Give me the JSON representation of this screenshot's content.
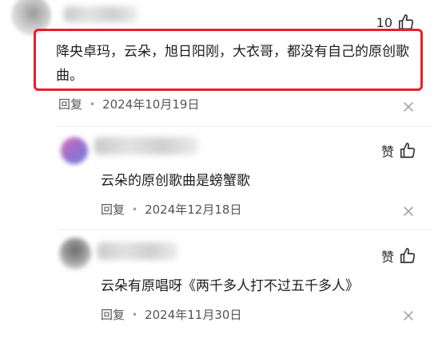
{
  "top_comment": {
    "likes": "10",
    "text": "降央卓玛，云朵，旭日阳刚，大衣哥，都没有自己的原创歌曲。",
    "reply_label": "回复",
    "date": "2024年10月19日"
  },
  "replies": [
    {
      "like_label": "赞",
      "text": "云朵的原创歌曲是螃蟹歌",
      "reply_label": "回复",
      "date": "2024年12月18日"
    },
    {
      "like_label": "赞",
      "text": "云朵有原唱呀《两千多人打不过五千多人》",
      "reply_label": "回复",
      "date": "2024年11月30日"
    }
  ],
  "icons": {
    "like": "thumbs-up-icon",
    "dismiss": "close-icon",
    "separator": "dot"
  },
  "colors": {
    "highlight_border": "#e5212d",
    "text_primary": "#1d1d1d",
    "text_meta": "#555555"
  }
}
